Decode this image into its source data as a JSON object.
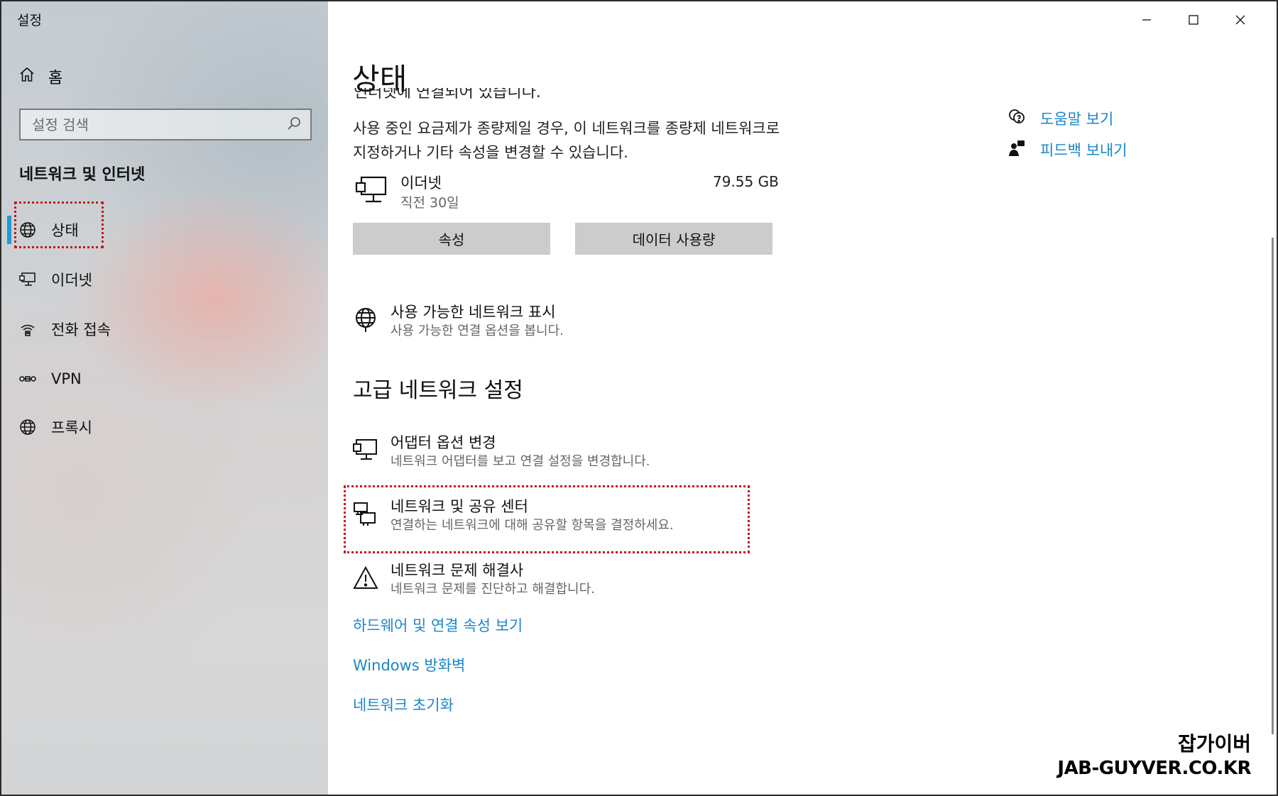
{
  "window": {
    "app_title": "설정",
    "controls": {
      "minimize_icon": "minimize-icon",
      "maximize_icon": "maximize-icon",
      "close_icon": "close-icon"
    }
  },
  "sidebar": {
    "home_label": "홈",
    "search_placeholder": "설정 검색",
    "section_title": "네트워크 및 인터넷",
    "items": [
      {
        "label": "상태",
        "icon": "globe-status-icon",
        "active": true
      },
      {
        "label": "이더넷",
        "icon": "ethernet-icon",
        "active": false
      },
      {
        "label": "전화 접속",
        "icon": "dialup-icon",
        "active": false
      },
      {
        "label": "VPN",
        "icon": "vpn-icon",
        "active": false
      },
      {
        "label": "프록시",
        "icon": "globe-icon",
        "active": false
      }
    ],
    "accent_color": "#1f9bd1"
  },
  "main": {
    "page_title": "상태",
    "cut_line": "인터넷에 연결되어 있습니다.",
    "description": "사용 중인 요금제가 종량제일 경우, 이 네트워크를 종량제 네트워크로 지정하거나 기타 속성을 변경할 수 있습니다.",
    "connection": {
      "name": "이더넷",
      "period": "직전 30일",
      "usage": "79.55 GB"
    },
    "buttons": {
      "properties": "속성",
      "data_usage": "데이터 사용량"
    },
    "show_networks": {
      "title": "사용 가능한 네트워크 표시",
      "subtitle": "사용 가능한 연결 옵션을 봅니다."
    },
    "advanced_heading": "고급 네트워크 설정",
    "advanced_items": [
      {
        "title": "어댑터 옵션 변경",
        "subtitle": "네트워크 어댑터를 보고 연결 설정을 변경합니다.",
        "icon": "adapter-icon"
      },
      {
        "title": "네트워크 및 공유 센터",
        "subtitle": "연결하는 네트워크에 대해 공유할 항목을 결정하세요.",
        "icon": "sharing-center-icon"
      },
      {
        "title": "네트워크 문제 해결사",
        "subtitle": "네트워크 문제를 진단하고 해결합니다.",
        "icon": "warning-icon"
      }
    ],
    "links": [
      "하드웨어 및 연결 속성 보기",
      "Windows 방화벽",
      "네트워크 초기화"
    ],
    "link_color": "#1a86c7"
  },
  "help_links": {
    "help": "도움말 보기",
    "feedback": "피드백 보내기"
  },
  "watermark": {
    "korean": "잡가이버",
    "url": "JAB-GUYVER.CO.KR"
  }
}
